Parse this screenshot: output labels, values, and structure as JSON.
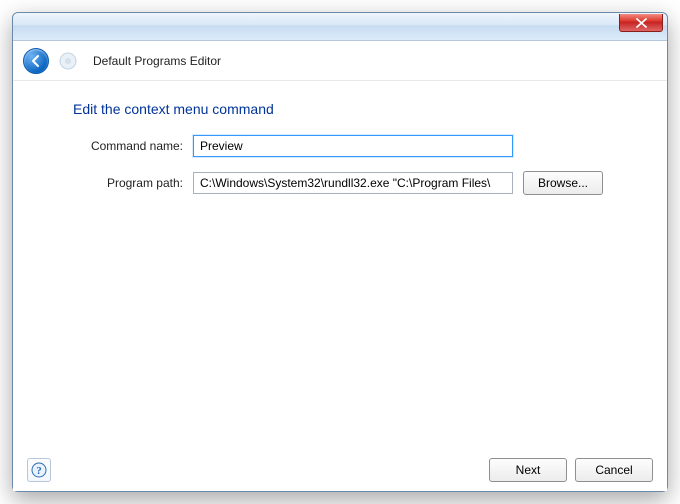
{
  "window": {
    "app_title": "Default Programs Editor"
  },
  "page": {
    "heading": "Edit the context menu command"
  },
  "form": {
    "command_name_label": "Command name:",
    "command_name_value": "Preview",
    "program_path_label": "Program path:",
    "program_path_value": "C:\\Windows\\System32\\rundll32.exe \"C:\\Program Files\\",
    "browse_label": "Browse..."
  },
  "footer": {
    "next_label": "Next",
    "cancel_label": "Cancel"
  }
}
